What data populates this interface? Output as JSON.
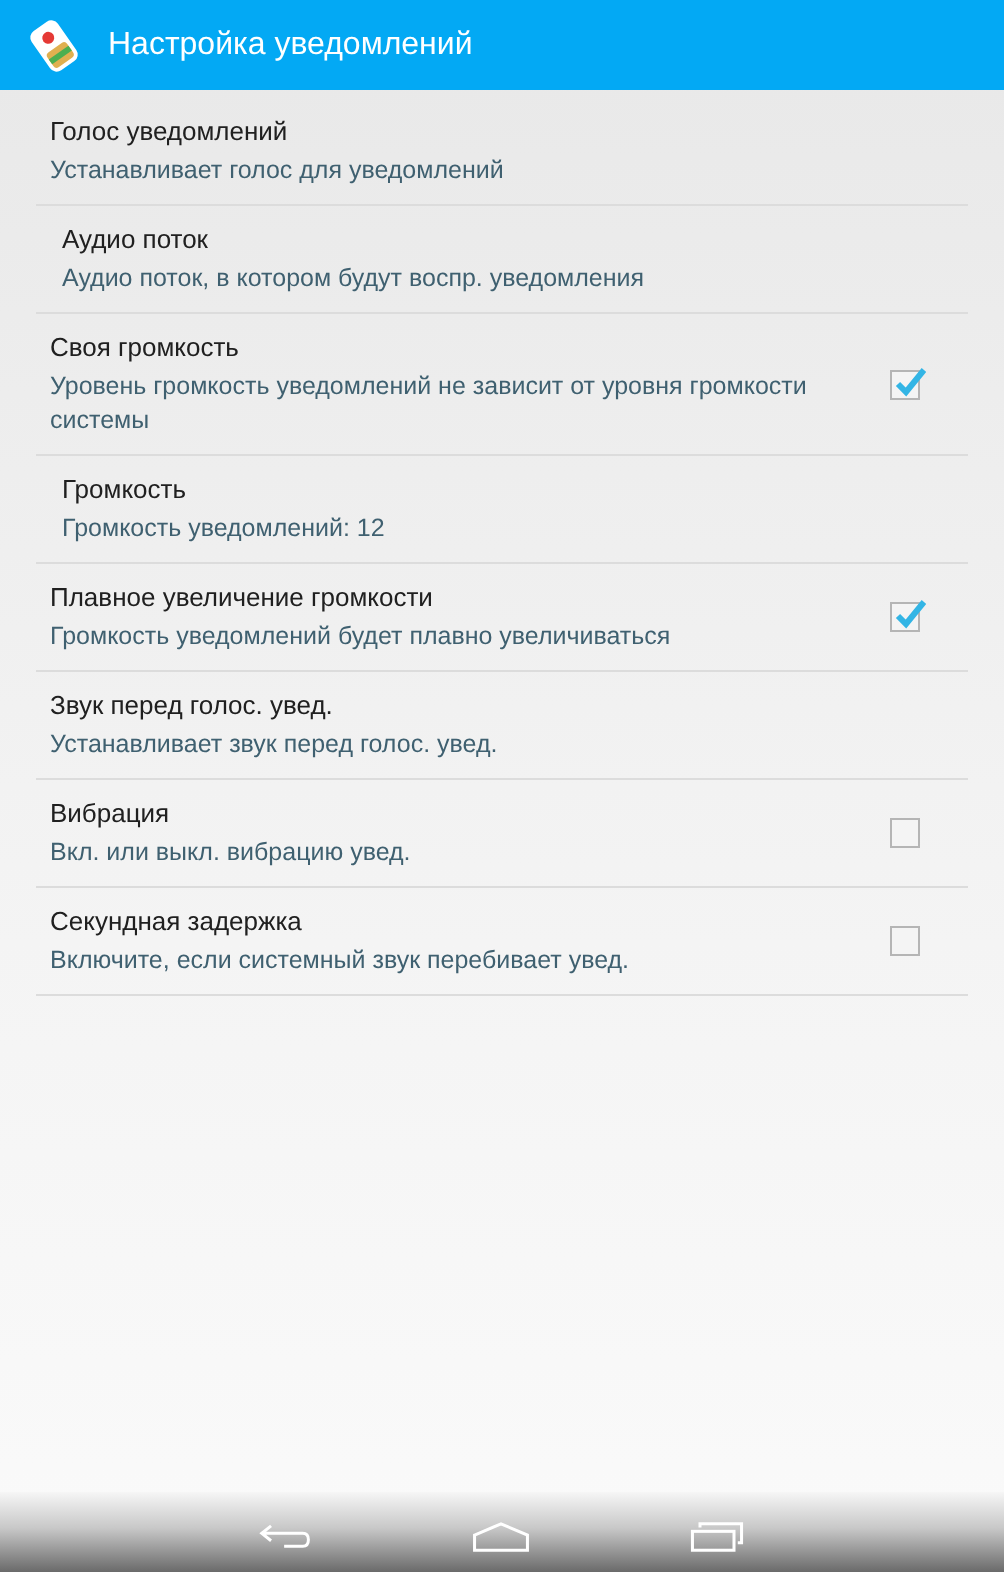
{
  "action_bar": {
    "title": "Настройка уведомлений"
  },
  "settings": [
    {
      "kind": "plain",
      "title": "Голос уведомлений",
      "summary": "Устанавливает голос для уведомлений"
    },
    {
      "kind": "nested",
      "title": "Аудио поток",
      "summary": "Аудио поток, в котором будут воспр. уведомления"
    },
    {
      "kind": "checkbox",
      "title": "Своя громкость",
      "summary": "Уровень громкость уведомлений не зависит от уровня громкости системы",
      "checked": true
    },
    {
      "kind": "nested",
      "title": "Громкость",
      "summary": "Громкость уведомлений: 12"
    },
    {
      "kind": "checkbox",
      "title": "Плавное увеличение громкости",
      "summary": "Громкость уведомлений будет плавно увеличиваться",
      "checked": true
    },
    {
      "kind": "plain",
      "title": "Звук перед голос. увед.",
      "summary": "Устанавливает звук перед голос. увед."
    },
    {
      "kind": "checkbox",
      "title": "Вибрация",
      "summary": "Вкл. или выкл. вибрацию увед.",
      "checked": false
    },
    {
      "kind": "checkbox",
      "title": "Секундная задержка",
      "summary": "Включите, если системный звук перебивает увед.",
      "checked": false
    }
  ]
}
